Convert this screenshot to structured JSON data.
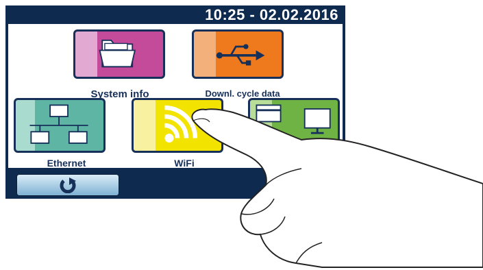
{
  "header": {
    "datetime": "10:25 - 02.02.2016"
  },
  "tiles": {
    "system_info": {
      "label": "System info",
      "icon": "folder-icon",
      "color": "#c44a9a"
    },
    "download_cycle_data": {
      "label": "Downl. cycle data",
      "icon": "usb-icon",
      "color": "#ef7a1d"
    },
    "ethernet": {
      "label": "Ethernet",
      "icon": "network-icon",
      "color": "#5fb5a4"
    },
    "wifi": {
      "label": "WiFi",
      "icon": "wifi-icon",
      "color": "#f2e400"
    },
    "display": {
      "label": "",
      "icon": "display-icon",
      "color": "#6fb344"
    }
  },
  "footer": {
    "back_icon": "rotate-back-icon"
  },
  "colors": {
    "frame": "#0e2a4f",
    "border": "#16305a"
  }
}
